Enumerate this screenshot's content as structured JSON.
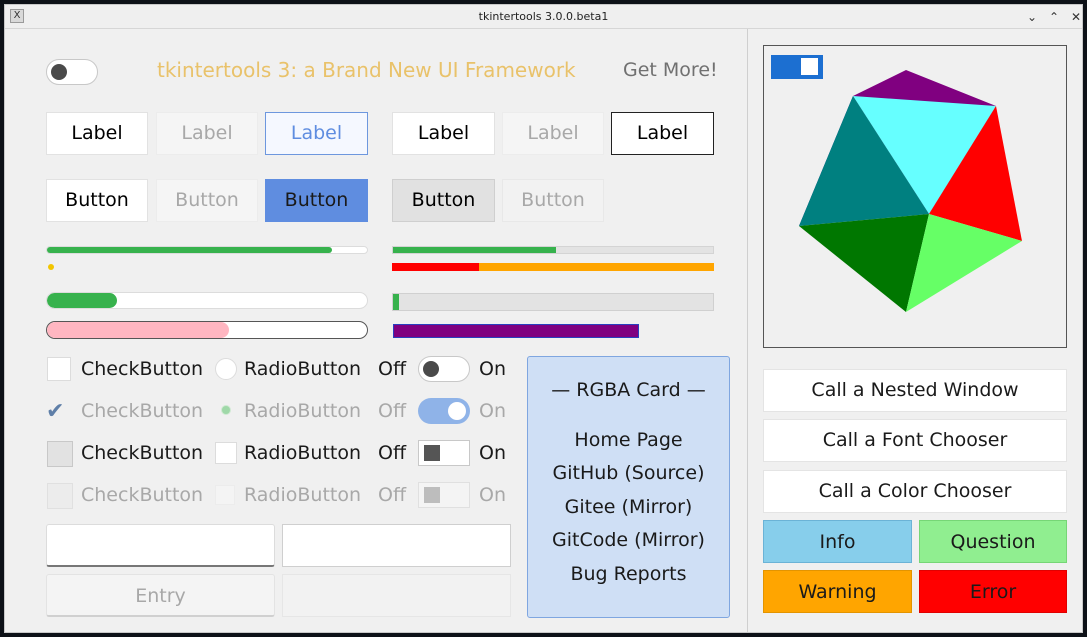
{
  "window": {
    "title": "tkintertools 3.0.0.beta1",
    "app_icon": "X"
  },
  "header": {
    "headline": "tkintertools 3: a Brand New UI Framework",
    "get_more": "Get More!"
  },
  "labels": [
    "Label",
    "Label",
    "Label",
    "Label",
    "Label",
    "Label"
  ],
  "buttons": [
    "Button",
    "Button",
    "Button",
    "Button",
    "Button"
  ],
  "progress": {
    "bar1": 0.89,
    "bar2": 0.51,
    "bar3_red": 0.27,
    "bar4": 0.22,
    "bar5": 0.57,
    "bar6": 0.02,
    "bar7": 1.0
  },
  "checks": {
    "checkbutton": "CheckButton",
    "radiobutton": "RadioButton",
    "off": "Off",
    "on": "On"
  },
  "entry": {
    "placeholder": "Entry"
  },
  "card": {
    "title": "— RGBA Card —",
    "links": [
      "Home Page",
      "GitHub (Source)",
      "Gitee (Mirror)",
      "GitCode (Mirror)",
      "Bug Reports"
    ]
  },
  "right": {
    "nested": "Call a Nested Window",
    "font": "Call a Font Chooser",
    "color": "Call a Color Chooser",
    "info": "Info",
    "question": "Question",
    "warning": "Warning",
    "error": "Error"
  },
  "colors": {
    "accent": "#5f8de0",
    "green": "#37b24d",
    "orange": "#ffa500",
    "red": "#ff0000",
    "purple": "#800080",
    "pink": "#ffb6c1",
    "info_bg": "#87ceeb",
    "question_bg": "#90ee90",
    "warning_bg": "#ffa500",
    "error_bg": "#ff0000"
  }
}
